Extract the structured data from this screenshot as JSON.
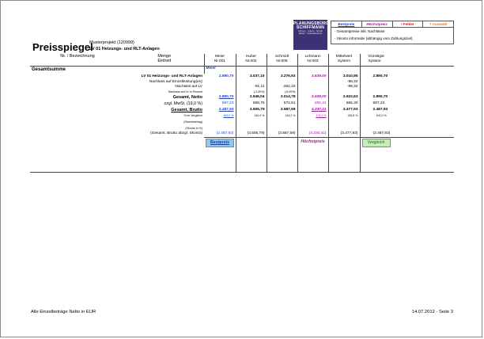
{
  "title": "Preisspiegel",
  "project": {
    "name": "Musterprojekt (120999)",
    "lv": "LV 01 Heizungs- und RLT-Anlagen"
  },
  "logo": {
    "line1": "PLANUNGSBÜRO",
    "line2": "SCHIFFMANN",
    "line3": "Heizung · Lüftung · Sanitär",
    "line4": "Elektro · Gebäudetechnik"
  },
  "legend": {
    "keys": [
      "Bestpreis",
      "Höchstpreis",
      "! Fehler",
      "? Auswahl"
    ],
    "line1": "-  Gesamtpreise inkl. Nachlässe",
    "line2": "-  Skonto informativ (abhängig vom Zahlungsziel)"
  },
  "header": {
    "col0": "Nr. / Bezeichnung",
    "col1": "Menge\nEinheit",
    "bidders": [
      {
        "name": "Meier",
        "nr": "Nr.001"
      },
      {
        "name": "Huber",
        "nr": "Nr.002"
      },
      {
        "name": "Schmidt",
        "nr": "Nr.005"
      },
      {
        "name": "Lehmann",
        "nr": "Nr.003"
      },
      {
        "name": "Mittelwert",
        "nr": "System"
      },
      {
        "name": "Günstigst",
        "nr": "System"
      }
    ]
  },
  "tag_meier": "Meier",
  "section": "Gesamtsumme",
  "rows": [
    {
      "label": "LV 01 Heizungs- und RLT-Anlagen",
      "values": [
        "2.890,70",
        "3.037,15",
        "3.276,93",
        "3.639,00",
        "3.010,95",
        "2.890,70"
      ]
    },
    {
      "label": "Nachlass auf Einzelleistung(en)",
      "values": [
        "",
        "",
        "",
        "",
        "-88,32",
        ""
      ]
    },
    {
      "label": "Nachlass auf LV",
      "values": [
        "",
        "-91,11",
        "-262,15",
        "",
        "-88,32",
        ""
      ]
    },
    {
      "label": "Nachlass auf LV in Prozent",
      "values": [
        "",
        "(-3,00%)",
        "(-8,00%)",
        "",
        "",
        ""
      ]
    },
    {
      "label": "Gesamt, Netto",
      "values": [
        "2.890,70",
        "2.946,04",
        "3.014,78",
        "3.639,00",
        "2.922,63",
        "2.890,70"
      ]
    },
    {
      "label": "zzgl. MwSt. (19,0 %)",
      "values": [
        "597,23",
        "559,75",
        "572,81",
        "691,41",
        "555,30",
        "597,23"
      ]
    },
    {
      "label": "Gesamt, Brutto",
      "values": [
        "2.487,93",
        "3.505,79",
        "3.587,59",
        "4.330,41",
        "3.477,93",
        "2.487,93"
      ]
    },
    {
      "label": "% im Vergleich",
      "values": [
        "100,0 %",
        "140,9 %",
        "144,2 %",
        "174,1 %",
        "139,8 %",
        "100,0 %"
      ]
    },
    {
      "label": "(Skontobetrag)",
      "values": [
        "",
        "",
        "",
        "",
        "",
        ""
      ]
    },
    {
      "label": "(Skonto in %)",
      "values": [
        "",
        "",
        "",
        "",
        "",
        ""
      ]
    },
    {
      "label": "(Gesamt, Brutto abzgl. Skonto)",
      "values": [
        "(2.487,93)",
        "(3.505,79)",
        "(3.587,59)",
        "(4.330,41)",
        "(3.477,93)",
        "(2.487,93)"
      ]
    }
  ],
  "badges": {
    "best": "Bestpreis",
    "high": "Höchstpreis",
    "compare": "Vergleich"
  },
  "footer": {
    "left": "Alle Einzelbeträge Netto in EUR",
    "right": "14.07.2012 - Seite 3"
  },
  "colors": {
    "best": "#1f45c6",
    "high": "#a3199e",
    "error": "#d21818",
    "select": "#e0792b",
    "logo_bg": "#3a3275",
    "best_bg": "#8fc7ee",
    "compare_bg": "#c6ecb9"
  }
}
